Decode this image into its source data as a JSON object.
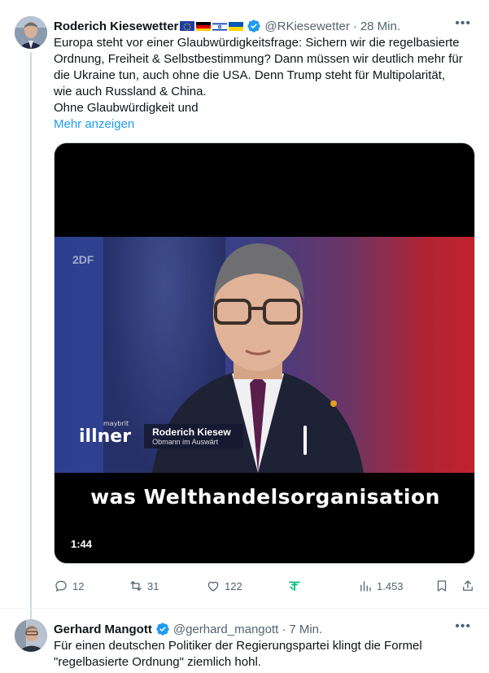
{
  "tweets": [
    {
      "author": {
        "name": "Roderich Kiesewetter",
        "flags": [
          "eu",
          "de",
          "il",
          "ua"
        ],
        "verified": true,
        "handle": "@RKiesewetter",
        "time": "28 Min."
      },
      "text_lines": [
        "Europa steht vor einer Glaubwürdigkeitsfrage: Sichern wir die regelbasierte",
        "Ordnung, Freiheit & Selbstbestimmung? Dann müssen wir deutlich mehr für",
        "die Ukraine tun, auch ohne die USA. Denn Trump steht für Multipolarität,",
        "wie auch Russland & China.",
        "Ohne Glaubwürdigkeit und"
      ],
      "show_more": "Mehr anzeigen",
      "video": {
        "channel_logo": "2DF",
        "show_logo": "illner",
        "show_logo_small": "maybrit",
        "lower_third_name": "Roderich Kiesew",
        "lower_third_title": "Obmann im Auswärt",
        "caption": "was Welthandelsorganisation",
        "duration": "1:44"
      },
      "stats": {
        "replies": "12",
        "reposts": "31",
        "likes": "122",
        "views": "1.453"
      },
      "more_icon": "more-dots-icon"
    },
    {
      "author": {
        "name": "Gerhard Mangott",
        "verified": true,
        "handle": "@gerhard_mangott",
        "time": "7 Min."
      },
      "text_lines": [
        "Für einen deutschen Politiker der Regierungspartei klingt die Formel",
        "\"regelbasierte Ordnung\" ziemlich hohl."
      ],
      "more_icon": "more-dots-icon"
    }
  ],
  "colors": {
    "accent": "#1d9bf0",
    "secondary_text": "#536471",
    "grok_green": "#00ba7c"
  }
}
